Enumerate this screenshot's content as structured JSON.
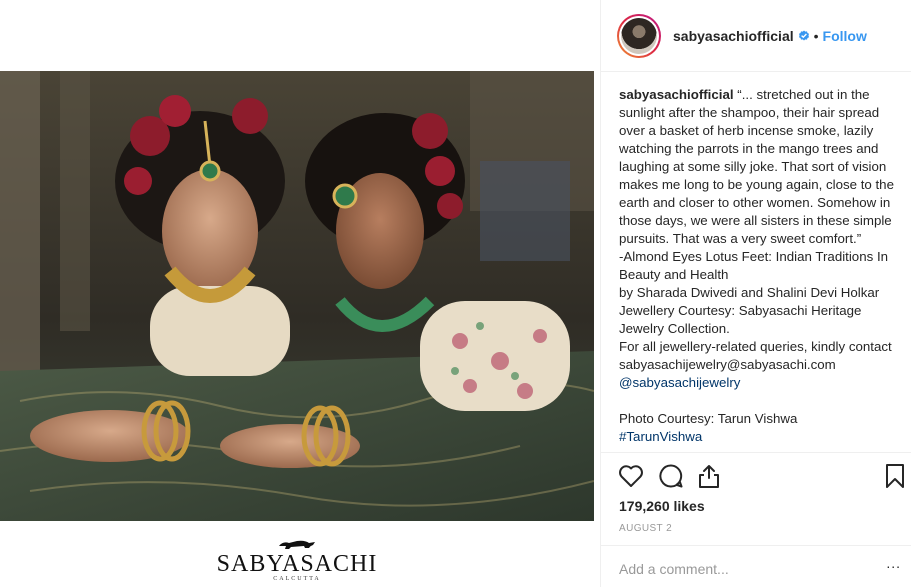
{
  "post": {
    "username": "sabyasachiofficial",
    "follow_label": "Follow",
    "separator": "•",
    "caption": {
      "user": "sabyasachiofficial",
      "quote": "“... stretched out in the sunlight after the shampoo, their hair spread over a basket of herb incense smoke, lazily watching the parrots in the mango trees and laughing at some silly joke. That sort of vision makes me long to be young again, close to the earth and closer to other women. Somehow in those days, we were all sisters in these simple pursuits. That was a very sweet comfort.”",
      "source_line": "-Almond Eyes Lotus Feet: Indian Traditions In Beauty and Health",
      "authors_line": "by Sharada Dwivedi and Shalini Devi Holkar",
      "courtesy_line": "Jewellery Courtesy: Sabyasachi Heritage Jewelry Collection.",
      "queries_line": "For all jewellery-related queries, kindly contact sabyasachijewelry@sabyasachi.com",
      "mention": "@sabyasachijewelry",
      "photo_line": "Photo Courtesy: Tarun Vishwa",
      "cut_tag": "#TarunVishwa"
    },
    "likes": "179,260 likes",
    "date": "AUGUST 2",
    "comment_placeholder": "Add a comment...",
    "more": "..."
  },
  "brand": {
    "wordmark": "SABYASACHI",
    "city": "CALCUTTA"
  },
  "colors": {
    "follow_blue": "#3897f0",
    "verified_blue": "#3897f0",
    "mention_blue": "#003569",
    "meta_gray": "#999999"
  },
  "icons": [
    "verified-badge-icon",
    "heart-icon",
    "comment-icon",
    "share-icon",
    "bookmark-icon",
    "tiger-logo-icon"
  ]
}
